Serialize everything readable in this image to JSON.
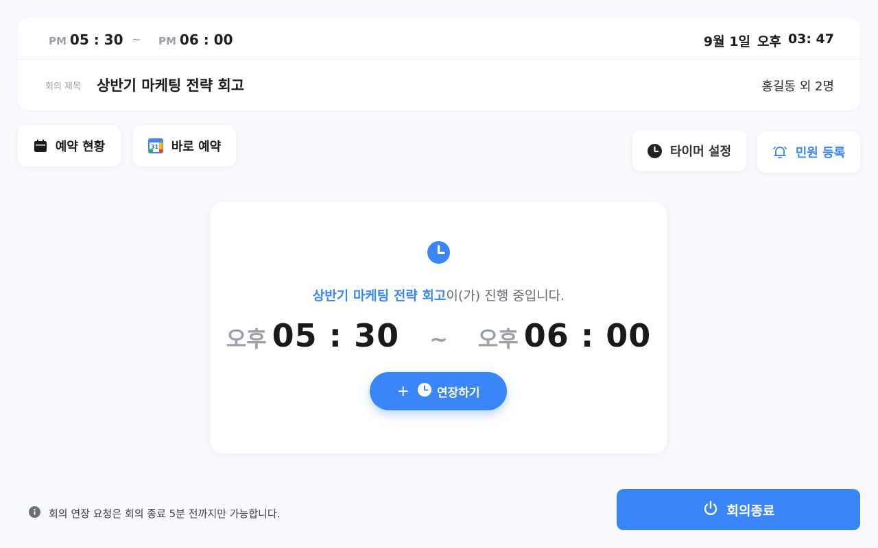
{
  "header": {
    "start": {
      "ampm": "PM",
      "time": "05 : 30"
    },
    "separator": "~",
    "end": {
      "ampm": "PM",
      "time": "06 : 00"
    },
    "now": {
      "date": "9월 1일",
      "ampm": "오후",
      "time": "03: 47"
    }
  },
  "meeting": {
    "title_label": "회의 제목",
    "title": "상반기 마케팅 전략 회고",
    "attendees": "홍길동 외 2명"
  },
  "actions": {
    "reservation_status": "예약 현황",
    "quick_reserve": "바로 예약",
    "calendar_day": "31",
    "timer_settings": "타이머 설정",
    "complaint": "민원 등록"
  },
  "status_card": {
    "meeting_title": "상반기 마케팅 전략 회고",
    "status_suffix": "이(가) 진행 중입니다.",
    "start": {
      "ampm": "오후",
      "time": "05 : 30"
    },
    "separator": "~",
    "end": {
      "ampm": "오후",
      "time": "06 : 00"
    },
    "extend_plus": "+",
    "extend_label": "연장하기"
  },
  "footer": {
    "notice": "회의 연장 요청은 회의 종료 5분 전까지만 가능합니다.",
    "end_meeting": "회의종료"
  },
  "colors": {
    "accent": "#3b86f7",
    "background": "#f7f9fc"
  }
}
